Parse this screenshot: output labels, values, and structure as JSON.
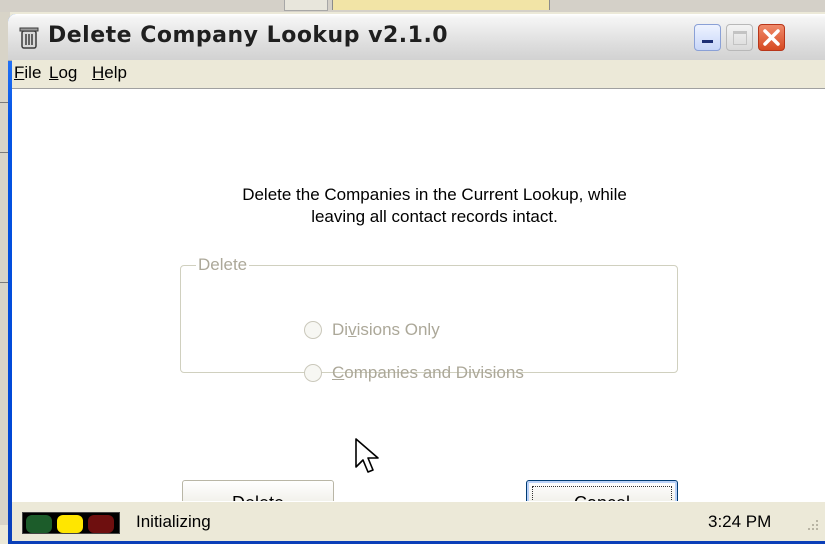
{
  "window": {
    "title": "Delete Company Lookup v2.1.0",
    "icon": "trash-can-icon"
  },
  "menu": [
    {
      "label": "File",
      "accel": "F",
      "rest": "ile"
    },
    {
      "label": "Log",
      "accel": "L",
      "rest": "og"
    },
    {
      "label": "Help",
      "accel": "H",
      "rest": "elp"
    }
  ],
  "main": {
    "description_line1": "Delete the Companies in the Current Lookup, while",
    "description_line2": "leaving all contact records intact."
  },
  "group": {
    "label": "Delete",
    "options": [
      {
        "pre": "Di",
        "accel": "v",
        "post": "isions Only",
        "label": "Divisions Only",
        "selected": false,
        "enabled": false
      },
      {
        "pre": "",
        "accel": "C",
        "post": "ompanies and Divisions",
        "label": "Companies and Divisions",
        "selected": false,
        "enabled": false
      }
    ]
  },
  "buttons": {
    "delete": {
      "accel": "D",
      "rest": "elete",
      "label": "Delete"
    },
    "cancel": {
      "label": "Cancel"
    }
  },
  "status": {
    "text": "Initializing",
    "time": "3:24 PM",
    "lights": [
      "green",
      "yellow",
      "red"
    ]
  },
  "colors": {
    "disabled_text": "#aca899",
    "light_yellow": "#ffe600",
    "light_green_dim": "#1c5c2a",
    "light_red_dim": "#6e0f0f"
  }
}
